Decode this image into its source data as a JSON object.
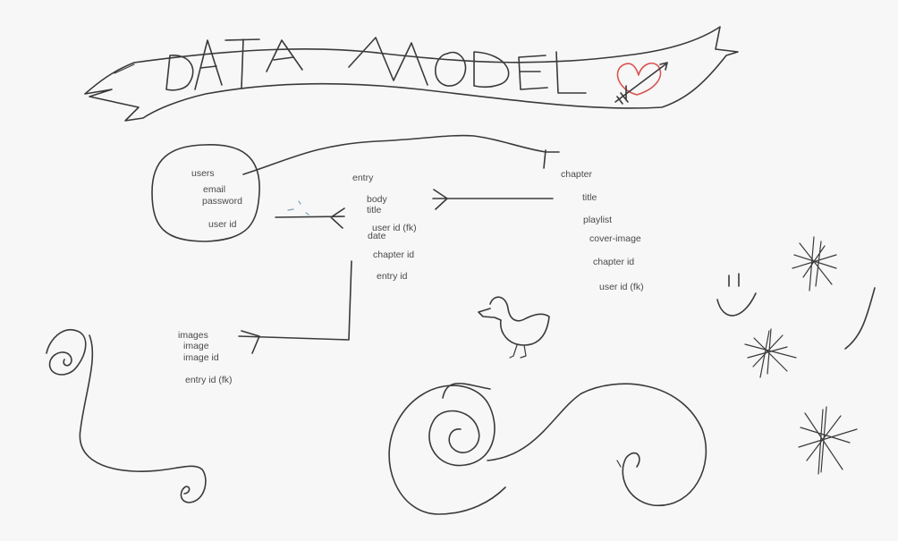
{
  "title": "DATA MODEL",
  "colors": {
    "ink": "#3a3a3a",
    "heart": "#d9534f",
    "background": "#f7f7f7"
  },
  "entities": {
    "users": {
      "name": "users",
      "fields": [
        "email",
        "password",
        "user id"
      ]
    },
    "entry": {
      "name": "entry",
      "fields": [
        "body",
        "title",
        "user id (fk)",
        "date",
        "chapter id",
        "entry id"
      ]
    },
    "chapter": {
      "name": "chapter",
      "fields": [
        "title",
        "playlist",
        "cover-image",
        "chapter id",
        "user id (fk)"
      ]
    },
    "images": {
      "name": "images",
      "fields": [
        "image",
        "image id",
        "entry id (fk)"
      ]
    }
  },
  "doodles": [
    "banner",
    "heart-icon",
    "duck",
    "spiral",
    "starburst",
    "smiley"
  ]
}
